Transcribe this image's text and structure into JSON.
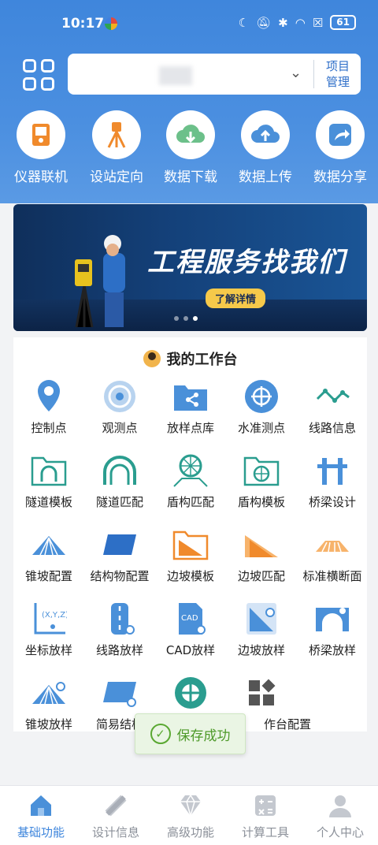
{
  "status_bar": {
    "time": "10:17",
    "battery": "61"
  },
  "project": {
    "name": "",
    "manage_label_line1": "项目",
    "manage_label_line2": "管理"
  },
  "quick_actions": [
    {
      "label": "仪器联机",
      "icon": "instrument-icon"
    },
    {
      "label": "设站定向",
      "icon": "tripod-icon"
    },
    {
      "label": "数据下载",
      "icon": "cloud-download-icon"
    },
    {
      "label": "数据上传",
      "icon": "cloud-upload-icon"
    },
    {
      "label": "数据分享",
      "icon": "share-icon"
    }
  ],
  "banner": {
    "title": "工程服务找我们",
    "button": "了解详情"
  },
  "workbench": {
    "title": "我的工作台",
    "items": [
      {
        "label": "控制点",
        "icon": "location-pin-icon"
      },
      {
        "label": "观测点",
        "icon": "target-icon"
      },
      {
        "label": "放样点库",
        "icon": "folder-share-icon"
      },
      {
        "label": "水准测点",
        "icon": "crosshair-icon"
      },
      {
        "label": "线路信息",
        "icon": "route-line-icon"
      },
      {
        "label": "隧道模板",
        "icon": "tunnel-folder-icon"
      },
      {
        "label": "隧道匹配",
        "icon": "tunnel-arch-icon"
      },
      {
        "label": "盾构匹配",
        "icon": "shield-machine-icon"
      },
      {
        "label": "盾构模板",
        "icon": "shield-folder-icon"
      },
      {
        "label": "桥梁设计",
        "icon": "bridge-pier-icon"
      },
      {
        "label": "锥坡配置",
        "icon": "cone-slope-icon"
      },
      {
        "label": "结构物配置",
        "icon": "structure-icon"
      },
      {
        "label": "边坡模板",
        "icon": "slope-folder-icon"
      },
      {
        "label": "边坡匹配",
        "icon": "slope-layers-icon"
      },
      {
        "label": "标准横断面",
        "icon": "cross-section-icon"
      },
      {
        "label": "坐标放样",
        "icon": "coordinate-icon"
      },
      {
        "label": "线路放样",
        "icon": "road-stakeout-icon"
      },
      {
        "label": "CAD放样",
        "icon": "cad-file-icon"
      },
      {
        "label": "边坡放样",
        "icon": "slope-stakeout-icon"
      },
      {
        "label": "桥梁放样",
        "icon": "bridge-stakeout-icon"
      },
      {
        "label": "锥坡放样",
        "icon": "cone-stakeout-icon"
      },
      {
        "label": "简易结构",
        "icon": "simple-structure-icon"
      },
      {
        "label": "",
        "icon": "ring-icon"
      },
      {
        "label": "作台配置",
        "icon": "grid-config-icon"
      }
    ]
  },
  "toast": {
    "text": "保存成功"
  },
  "tabbar": [
    {
      "label": "基础功能",
      "icon": "home-icon",
      "active": true
    },
    {
      "label": "设计信息",
      "icon": "ruler-pencil-icon",
      "active": false
    },
    {
      "label": "高级功能",
      "icon": "diamond-icon",
      "active": false
    },
    {
      "label": "计算工具",
      "icon": "calculator-icon",
      "active": false
    },
    {
      "label": "个人中心",
      "icon": "person-icon",
      "active": false
    }
  ],
  "colors": {
    "primary": "#3f86dc",
    "accent_orange": "#f08a2c",
    "icon_blue": "#4a90d9",
    "icon_teal": "#2a9d8f",
    "success": "#5aa832"
  }
}
